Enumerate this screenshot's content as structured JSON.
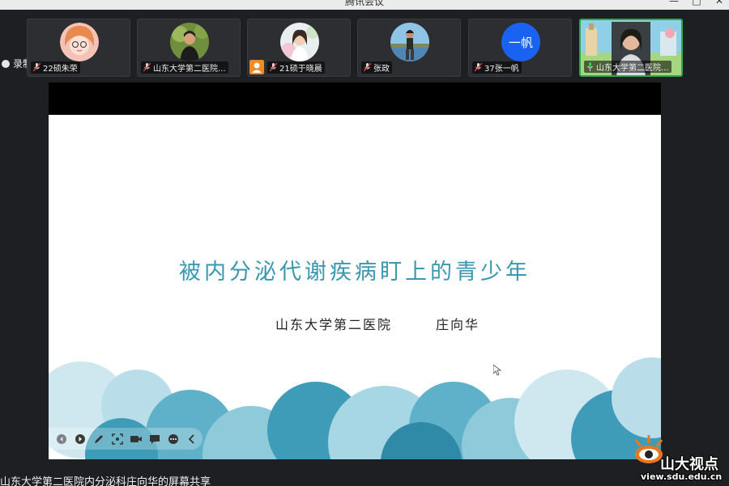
{
  "app": {
    "title": "腾讯会议"
  },
  "window_controls": {
    "minimize": "—",
    "maximize": "□",
    "close": "✕"
  },
  "recording": {
    "label": "录制中"
  },
  "participants": [
    {
      "name": "22硕朱荣",
      "mic": "muted",
      "avatar": "cartoon-girl-avatar"
    },
    {
      "name": "山东大学第二医院...",
      "mic": "muted",
      "avatar": "photo-avatar"
    },
    {
      "name": "21硕于晓晨",
      "mic": "muted",
      "avatar": "photo-avatar",
      "badge": "user-badge"
    },
    {
      "name": "张政",
      "mic": "muted",
      "avatar": "photo-avatar"
    },
    {
      "name": "37张一帆",
      "mic": "muted",
      "avatar": "text-avatar",
      "avatar_text": "一帆"
    },
    {
      "name": "山东大学第二医院...",
      "mic": "active",
      "avatar": "video-feed",
      "speaking": true
    }
  ],
  "slide": {
    "title": "被内分泌代谢疾病盯上的青少年",
    "organization": "山东大学第二医院",
    "author": "庄向华"
  },
  "share": {
    "label": "山东大学第二医院内分泌科庄向华的屏幕共享"
  },
  "watermark": {
    "brand": "山大视点",
    "url": "view.sdu.edu.cn"
  },
  "colors": {
    "accent_title": "#3a97b0",
    "speaking_border": "#2fa84f",
    "text_avatar_bg": "#1a63f0"
  }
}
